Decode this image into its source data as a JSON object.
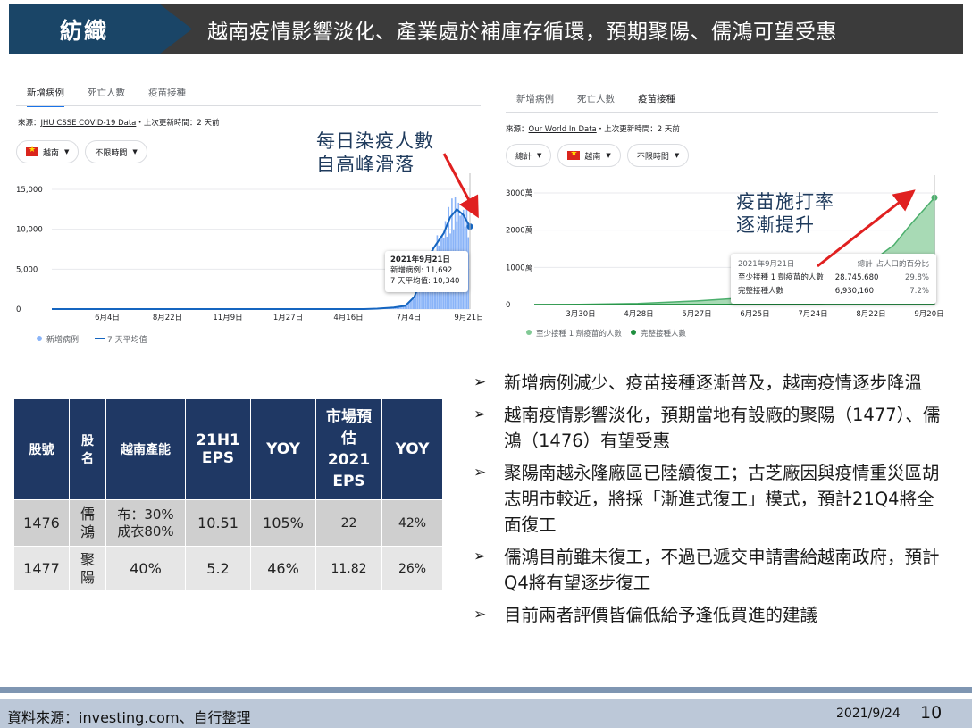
{
  "header": {
    "tag": "紡織",
    "title": "越南疫情影響淡化、產業處於補庫存循環，預期聚陽、儒鴻可望受惠"
  },
  "left_panel": {
    "tabs": [
      "新增病例",
      "死亡人數",
      "疫苗接種"
    ],
    "active_tab": 0,
    "source_prefix": "來源：",
    "source_link": "JHU CSSE COVID-19 Data",
    "source_suffix": "・上次更新時間：2 天前",
    "chip_country": "越南",
    "chip_period": "不限時間",
    "annotation": [
      "每日染疫人數",
      "自高峰滑落"
    ],
    "tooltip": {
      "date": "2021年9月21日",
      "line1_label": "新增病例:",
      "line1_value": "11,692",
      "line2_label": "7 天平均值:",
      "line2_value": "10,340"
    },
    "legend": [
      "新增病例",
      "7 天平均值"
    ]
  },
  "right_panel": {
    "tabs": [
      "新增病例",
      "死亡人數",
      "疫苗接種"
    ],
    "active_tab": 2,
    "source_prefix": "來源：",
    "source_link": "Our World In Data",
    "source_suffix": "・上次更新時間：2 天前",
    "chip_total": "總計",
    "chip_country": "越南",
    "chip_period": "不限時間",
    "annotation": [
      "疫苗施打率",
      "逐漸提升"
    ],
    "tooltip": {
      "date": "2021年9月21日",
      "col_total": "總計",
      "col_pct": "占人口的百分比",
      "row1_label": "至少接種 1 劑疫苗的人數",
      "row1_total": "28,745,680",
      "row1_pct": "29.8%",
      "row2_label": "完整接種人數",
      "row2_total": "6,930,160",
      "row2_pct": "7.2%"
    },
    "legend": [
      "至少接種 1 劑疫苗的人數",
      "完整接種人數"
    ]
  },
  "chart_data": [
    {
      "type": "line",
      "title": "",
      "x": [
        "2021-04-29",
        "2021-05-15",
        "2021-05-31",
        "2021-06-20",
        "2021-07-04",
        "2021-07-15",
        "2021-07-25",
        "2021-08-01",
        "2021-08-10",
        "2021-08-20",
        "2021-08-28",
        "2021-09-05",
        "2021-09-13",
        "2021-09-21"
      ],
      "series": [
        {
          "name": "7 天平均值",
          "values": [
            0,
            0,
            50,
            200,
            400,
            1500,
            4000,
            6500,
            8000,
            9500,
            11500,
            12500,
            11800,
            10340
          ]
        }
      ],
      "xticks": [
        "6月4日",
        "8月22日",
        "11月9日",
        "1月27日",
        "4月16日",
        "7月4日",
        "9月21日"
      ],
      "yticks": [
        "0",
        "5,000",
        "10,000",
        "15,000"
      ],
      "ylim": [
        0,
        15000
      ],
      "grid": true,
      "legend": "bottom-left"
    },
    {
      "type": "area",
      "title": "",
      "x": [
        "2021-03-08",
        "2021-03-30",
        "2021-04-28",
        "2021-05-27",
        "2021-06-25",
        "2021-07-24",
        "2021-08-10",
        "2021-08-22",
        "2021-09-01",
        "2021-09-10",
        "2021-09-21"
      ],
      "series": [
        {
          "name": "至少接種 1 劑疫苗的人數",
          "values": [
            0,
            50000,
            300000,
            1000000,
            2000000,
            4000000,
            8000000,
            12000000,
            16000000,
            22000000,
            28745680
          ]
        },
        {
          "name": "完整接種人數",
          "values": [
            0,
            0,
            0,
            30000,
            100000,
            300000,
            700000,
            1200000,
            2500000,
            4500000,
            6930160
          ]
        }
      ],
      "xticks": [
        "3月30日",
        "4月28日",
        "5月27日",
        "6月25日",
        "7月24日",
        "8月22日",
        "9月20日"
      ],
      "yticks": [
        "0",
        "1000萬",
        "2000萬",
        "3000萬"
      ],
      "ylim": [
        0,
        30000000
      ],
      "grid": true,
      "legend": "bottom-left"
    }
  ],
  "table": {
    "headers": [
      "股號",
      "股名",
      "越南產能",
      "21H1 EPS",
      "YOY",
      "市場預估2021 EPS",
      "YOY"
    ],
    "rows": [
      [
        "1476",
        "儒鴻",
        "布：30%成衣80%",
        "10.51",
        "105%",
        "22",
        "42%"
      ],
      [
        "1477",
        "聚陽",
        "40%",
        "5.2",
        "46%",
        "11.82",
        "26%"
      ]
    ]
  },
  "bullets": [
    "新增病例減少、疫苗接種逐漸普及，越南疫情逐步降溫",
    "越南疫情影響淡化，預期當地有設廠的聚陽（1477）、儒鴻（1476）有望受惠",
    "聚陽南越永隆廠區已陸續復工；古芝廠因與疫情重災區胡志明市較近，將採「漸進式復工」模式，預計21Q4將全面復工",
    "儒鴻目前雖未復工，不過已遞交申請書給越南政府，預計Q4將有望逐步復工",
    "目前兩者評價皆偏低給予逢低買進的建議"
  ],
  "footer": {
    "source_prefix": "資料來源：",
    "source_link": "investing.com",
    "source_suffix": "、自行整理",
    "date": "2021/9/24",
    "page": "10"
  },
  "colors": {
    "header_bg": "#3b3b3b",
    "tag_bg": "#1a4567",
    "table_header": "#1f3864",
    "case_line": "#1565c0",
    "case_bar": "#8ab4f8",
    "vaccine_dose1": "#81c995",
    "vaccine_full": "#1e8e3e",
    "annotation_arrow": "#e02020"
  }
}
